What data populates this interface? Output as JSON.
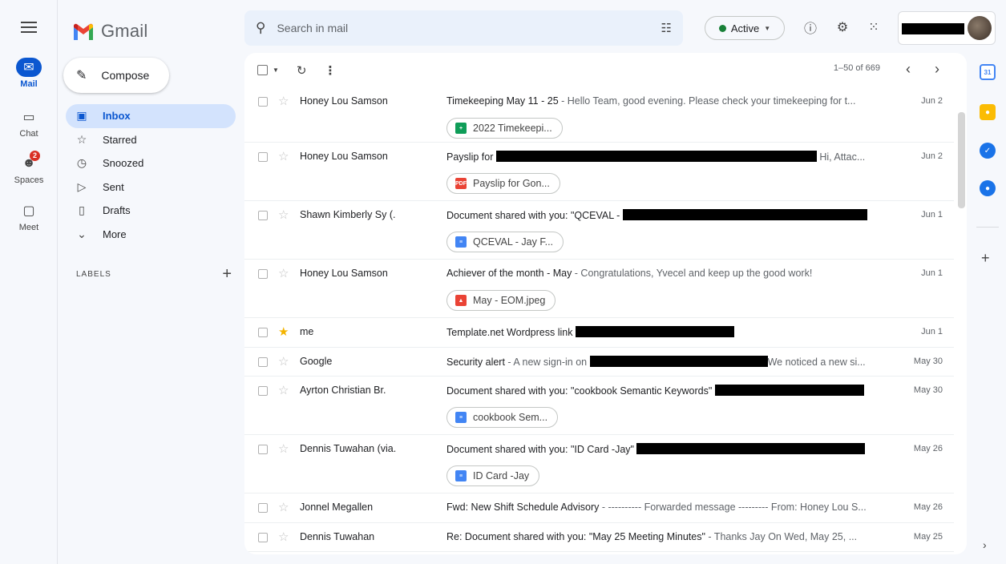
{
  "app": {
    "name": "Gmail"
  },
  "rail": [
    {
      "label": "Mail",
      "icon": "mail-icon",
      "active": true
    },
    {
      "label": "Chat",
      "icon": "chat-icon"
    },
    {
      "label": "Spaces",
      "icon": "spaces-icon",
      "badge": "2"
    },
    {
      "label": "Meet",
      "icon": "meet-icon"
    }
  ],
  "compose": {
    "label": "Compose"
  },
  "nav": [
    {
      "label": "Inbox",
      "icon": "inbox-icon",
      "glyph": "▣",
      "active": true
    },
    {
      "label": "Starred",
      "icon": "star-icon",
      "glyph": "☆"
    },
    {
      "label": "Snoozed",
      "icon": "clock-icon",
      "glyph": "◷"
    },
    {
      "label": "Sent",
      "icon": "send-icon",
      "glyph": "▷"
    },
    {
      "label": "Drafts",
      "icon": "draft-icon",
      "glyph": "▯"
    },
    {
      "label": "More",
      "icon": "chevron-down-icon",
      "glyph": "⌄"
    }
  ],
  "labels": {
    "title": "LABELS",
    "add": "+"
  },
  "search": {
    "placeholder": "Search in mail"
  },
  "status": {
    "label": "Active",
    "color": "#188038"
  },
  "pager": {
    "range": "1–50 of 669"
  },
  "emails": [
    {
      "sender": "Honey Lou Samson",
      "subject": "Timekeeping May 11 - 25",
      "snippet": " - Hello Team, good evening. Please check your timekeeping for t...",
      "date": "Jun 2",
      "chip": {
        "label": "2022 Timekeepi...",
        "type": "sheets",
        "color": "#0f9d58",
        "glyph": "+"
      }
    },
    {
      "sender": "Honey Lou Samson",
      "subject": "Payslip for",
      "redact_after_subject": 400,
      "snippet": " Hi, Attac...",
      "date": "Jun 2",
      "chip": {
        "label": "Payslip for Gon...",
        "type": "pdf",
        "color": "#ea4335",
        "glyph": "PDF"
      }
    },
    {
      "sender": "Shawn Kimberly Sy (.",
      "subject": "Document shared with you: \"QCEVAL -",
      "redact_after_subject": 305,
      "snippet": "",
      "date": "Jun 1",
      "chip": {
        "label": "QCEVAL - Jay F...",
        "type": "docs",
        "color": "#4285f4",
        "glyph": "≡"
      }
    },
    {
      "sender": "Honey Lou Samson",
      "subject": "Achiever of the month - May",
      "snippet": " - Congratulations, Yvecel and keep up the good work!",
      "date": "Jun 1",
      "chip": {
        "label": "May - EOM.jpeg",
        "type": "image",
        "color": "#ea4335",
        "glyph": "▲"
      }
    },
    {
      "sender": "me",
      "starred": true,
      "subject": "Template.net Wordpress link",
      "redact_after_subject": 198,
      "snippet": "",
      "date": "Jun 1"
    },
    {
      "sender": "Google",
      "subject": "Security alert",
      "snippet": " - A new sign-in on",
      "redact_after_subject": 222,
      "snippet_after": "We noticed a new si...",
      "date": "May 30"
    },
    {
      "sender": "Ayrton Christian Br.",
      "subject": "Document shared with you: \"cookbook Semantic Keywords\"",
      "redact_after_subject": 186,
      "snippet": "",
      "date": "May 30",
      "chip": {
        "label": "cookbook Sem...",
        "type": "docs",
        "color": "#4285f4",
        "glyph": "≡"
      }
    },
    {
      "sender": "Dennis Tuwahan (via.",
      "subject": "Document shared with you: \"ID Card -Jay\"",
      "redact_after_subject": 285,
      "snippet": "",
      "date": "May 26",
      "chip": {
        "label": "ID Card -Jay",
        "type": "docs",
        "color": "#4285f4",
        "glyph": "≡"
      }
    },
    {
      "sender": "Jonnel Megallen",
      "subject": "Fwd: New Shift Schedule Advisory",
      "snippet": " - ---------- Forwarded message --------- From: Honey Lou S...",
      "date": "May 26"
    },
    {
      "sender": "Dennis Tuwahan",
      "subject": "Re: Document shared with you: \"May 25 Meeting Minutes\"",
      "snippet": " - Thanks Jay On Wed, May 25, ...",
      "date": "May 25"
    }
  ],
  "side_apps": [
    {
      "icon": "calendar-icon",
      "color": "#4285f4",
      "glyph": "31"
    },
    {
      "icon": "keep-icon",
      "color": "#fbbc04",
      "glyph": "●"
    },
    {
      "icon": "tasks-icon",
      "color": "#1a73e8",
      "glyph": "✓"
    },
    {
      "icon": "contacts-icon",
      "color": "#1a73e8",
      "glyph": "●"
    }
  ]
}
